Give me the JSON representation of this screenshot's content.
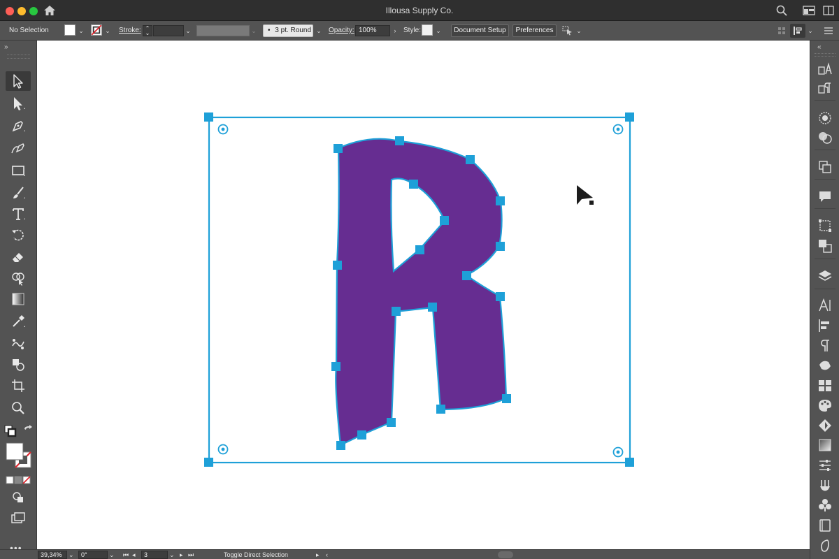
{
  "window": {
    "title": "Illousa Supply Co."
  },
  "controlbar": {
    "selection_label": "No Selection",
    "stroke_label": "Stroke:",
    "brush_value": "3 pt. Round",
    "opacity_label": "Opacity:",
    "opacity_value": "100%",
    "style_label": "Style:",
    "document_setup": "Document Setup",
    "preferences": "Preferences"
  },
  "statusbar": {
    "zoom": "39,34%",
    "rotation": "0°",
    "artboard": "3",
    "status_text": "Toggle Direct Selection"
  },
  "colors": {
    "selection": "#1ea0d8",
    "letter_fill": "#662d91",
    "canvas": "#ffffff",
    "ui_bg": "#535353"
  },
  "canvas": {
    "letter": "R"
  }
}
